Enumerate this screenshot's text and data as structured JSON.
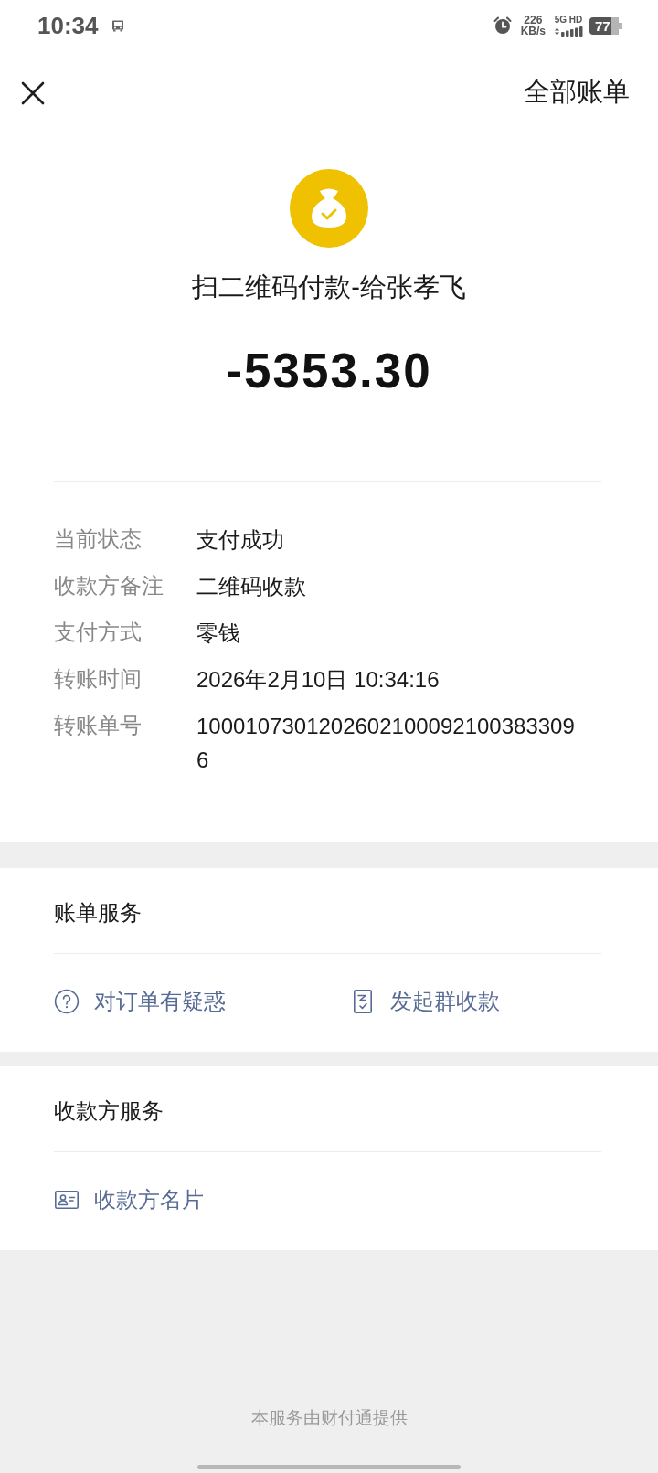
{
  "status_bar": {
    "time": "10:34",
    "speed_value": "226",
    "speed_unit": "KB/s",
    "network": "5G HD",
    "battery": "77"
  },
  "header": {
    "all_bills": "全部账单"
  },
  "payment": {
    "title": "扫二维码付款-给张孝飞",
    "amount": "-5353.30"
  },
  "details": [
    {
      "label": "当前状态",
      "value": "支付成功"
    },
    {
      "label": "收款方备注",
      "value": "二维码收款"
    },
    {
      "label": "支付方式",
      "value": "零钱"
    },
    {
      "label": "转账时间",
      "value": "2026年2月10日 10:34:16"
    },
    {
      "label": "转账单号",
      "value": "10001073012026021000921003833096"
    }
  ],
  "sections": [
    {
      "title": "账单服务",
      "items": [
        {
          "kind": "inquiry",
          "label": "对订单有疑惑"
        },
        {
          "kind": "group_collect",
          "label": "发起群收款"
        }
      ]
    },
    {
      "title": "收款方服务",
      "items": [
        {
          "kind": "payee_card",
          "label": "收款方名片"
        }
      ]
    }
  ],
  "footer": "本服务由财付通提供"
}
